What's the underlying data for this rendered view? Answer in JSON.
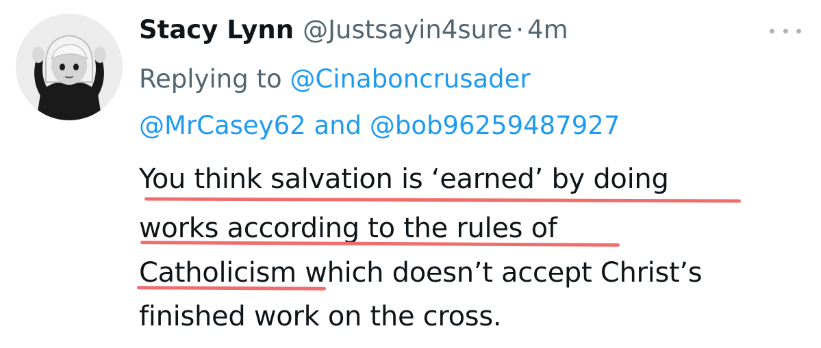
{
  "tweet": {
    "display_name": "Stacy Lynn",
    "handle": "@Justsayin4sure",
    "separator": "·",
    "time": "4m",
    "more_icon": "more-horizontal-icon",
    "avatar_icon": "woman-shrugging-emoji",
    "replying_prefix": "Replying to",
    "mentions": {
      "first": "@Cinaboncrusader",
      "second": "@MrCasey62",
      "joiner": "and",
      "third": "@bob96259487927"
    },
    "body_lines": [
      "You think salvation is ‘earned’ by doing",
      "works according to the rules of",
      "Catholicism which doesn’t accept Christ’s",
      "finished work on the cross."
    ],
    "highlight_color": "#f06d6d"
  },
  "colors": {
    "name": "#0f1419",
    "secondary": "#536471",
    "link": "#1d9bf0"
  }
}
